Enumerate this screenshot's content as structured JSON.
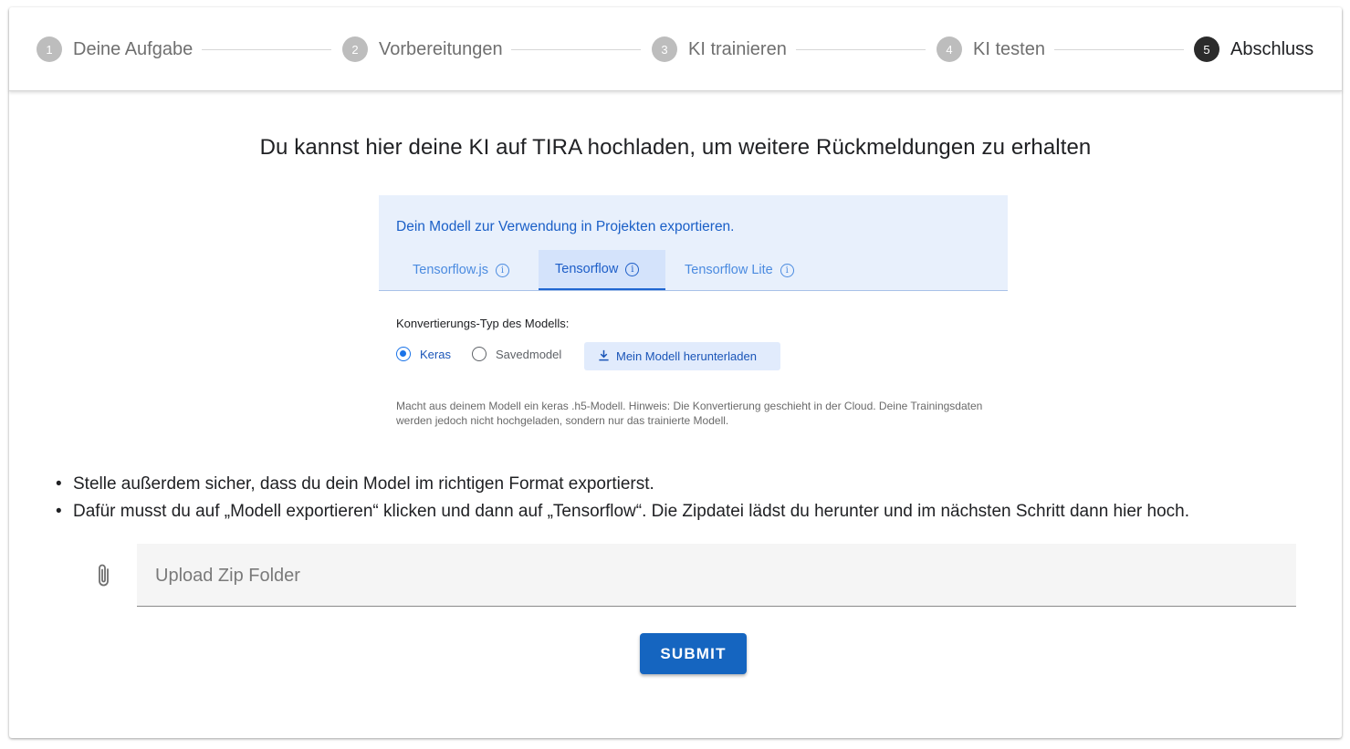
{
  "stepper": {
    "steps": [
      {
        "number": "1",
        "label": "Deine Aufgabe"
      },
      {
        "number": "2",
        "label": "Vorbereitungen"
      },
      {
        "number": "3",
        "label": "KI trainieren"
      },
      {
        "number": "4",
        "label": "KI testen"
      },
      {
        "number": "5",
        "label": "Abschluss"
      }
    ],
    "active_step": 5
  },
  "heading": "Du kannst hier deine KI auf TIRA hochladen, um weitere Rückmeldungen zu erhalten",
  "export_panel": {
    "title": "Dein Modell zur Verwendung in Projekten exportieren.",
    "tabs": [
      {
        "label": "Tensorflow.js"
      },
      {
        "label": "Tensorflow"
      },
      {
        "label": "Tensorflow Lite"
      }
    ],
    "active_tab": "Tensorflow",
    "conversion_label": "Konvertierungs-Typ des Modells:",
    "radio_options": [
      "Keras",
      "Savedmodel"
    ],
    "selected_option": "Keras",
    "download_label": "Mein Modell herunterladen",
    "hint": "Macht aus deinem Modell ein keras .h5-Modell. Hinweis: Die Konvertierung geschieht in der Cloud. Deine Trainingsdaten werden jedoch nicht hochgeladen, sondern nur das trainierte Modell."
  },
  "bullets": [
    "Stelle außerdem sicher, dass du dein Model im richtigen Format exportierst.",
    "Dafür musst du auf „Modell exportieren“ klicken und dann auf „Tensorflow“. Die Zipdatei lädst du herunter und im nächsten Schritt dann hier hoch."
  ],
  "upload": {
    "placeholder": "Upload Zip Folder",
    "icon": "paperclip-icon"
  },
  "submit_label": "SUBMIT",
  "colors": {
    "primary": "#1565c0",
    "active_step": "#2b2b2b",
    "inactive_step": "#bdbdbd"
  }
}
